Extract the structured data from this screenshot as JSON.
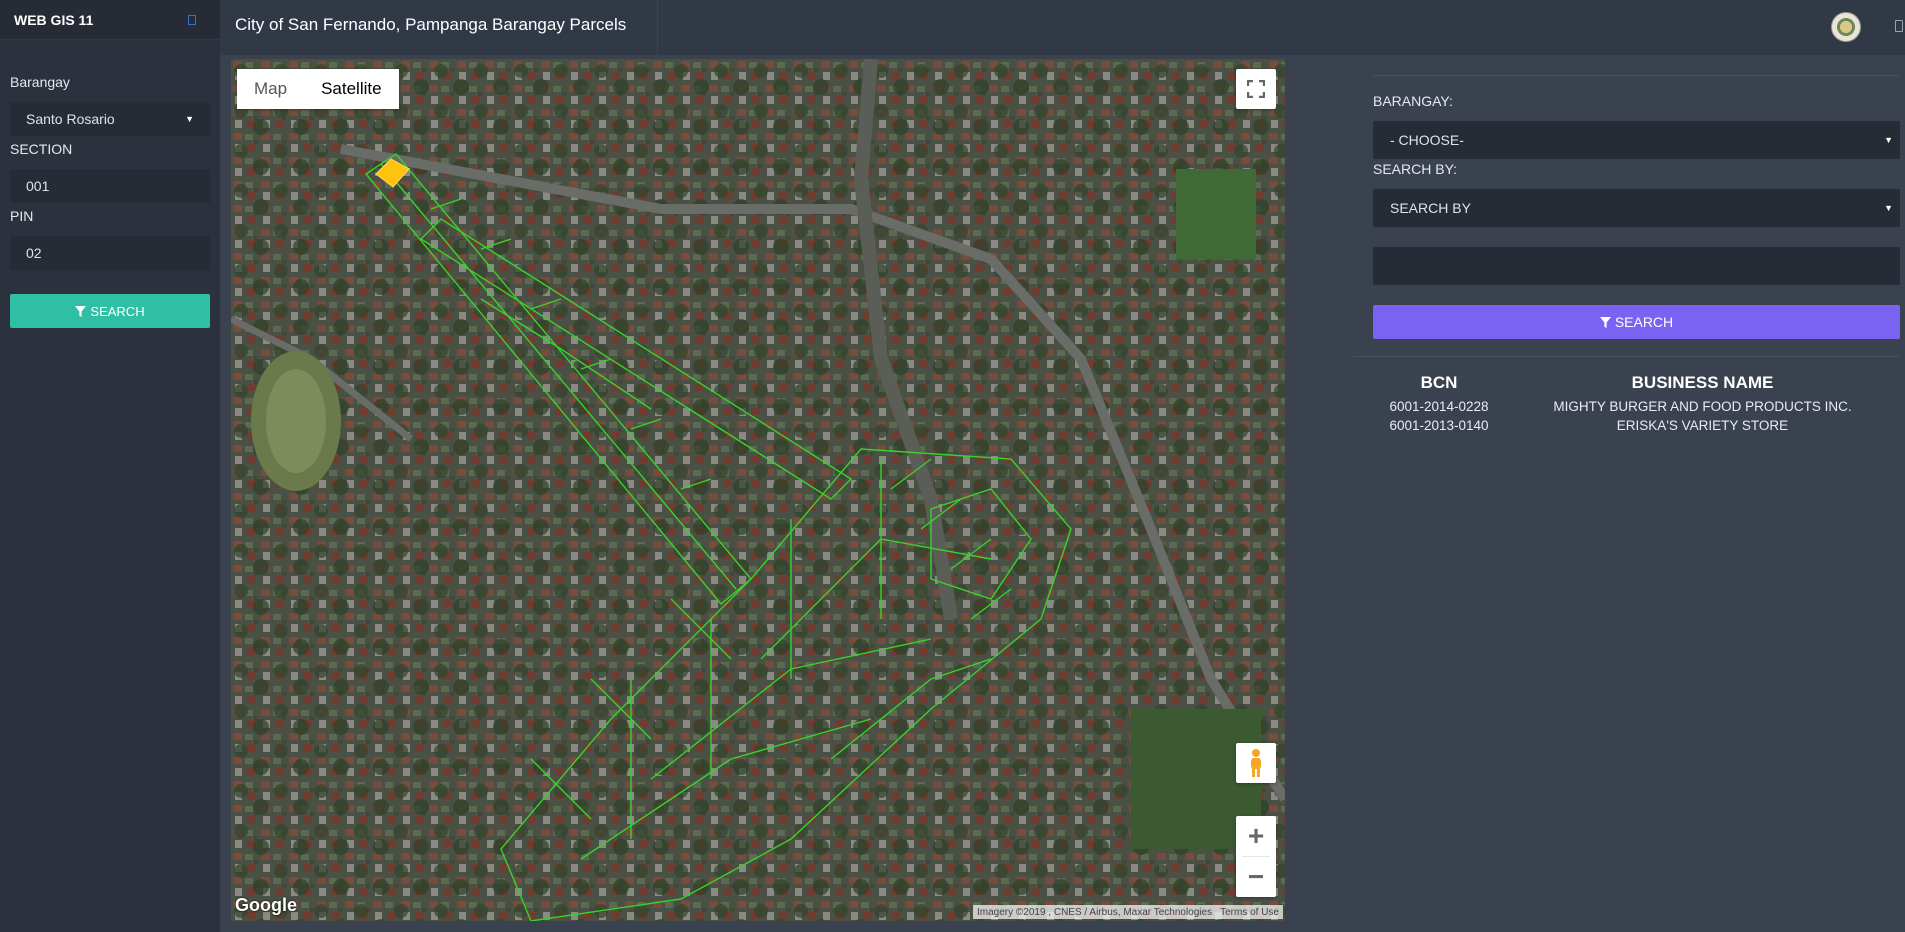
{
  "sidebar": {
    "brand": "WEB GIS 11",
    "barangay_label": "Barangay",
    "barangay_value": "Santo Rosario",
    "section_label": "SECTION",
    "section_value": "001",
    "pin_label": "PIN",
    "pin_value": "02",
    "search_label": "SEARCH",
    "search_icon": "filter-icon"
  },
  "header": {
    "title": "City of San Fernando, Pampanga Barangay Parcels"
  },
  "map": {
    "type_map": "Map",
    "type_satellite": "Satellite",
    "selected_type": "Satellite",
    "zoom_in": "+",
    "zoom_out": "−",
    "logo": "Google",
    "attribution": "Imagery ©2019 , CNES / Airbus, Maxar Technologies",
    "terms": "Terms of Use",
    "parcel_color": "#39d32a",
    "highlight_color": "#ffc20e"
  },
  "panel": {
    "barangay_label": "BARANGAY:",
    "barangay_select": "- CHOOSE-",
    "searchby_label": "SEARCH BY:",
    "searchby_select": "SEARCH BY",
    "search_input": "",
    "search_label": "SEARCH",
    "search_color": "#7a62f2",
    "table": {
      "headers": [
        "BCN",
        "BUSINESS NAME"
      ],
      "rows": [
        [
          "6001-2014-0228",
          "MIGHTY BURGER AND FOOD PRODUCTS INC."
        ],
        [
          "6001-2013-0140",
          "ERISKA'S VARIETY STORE"
        ]
      ]
    }
  }
}
